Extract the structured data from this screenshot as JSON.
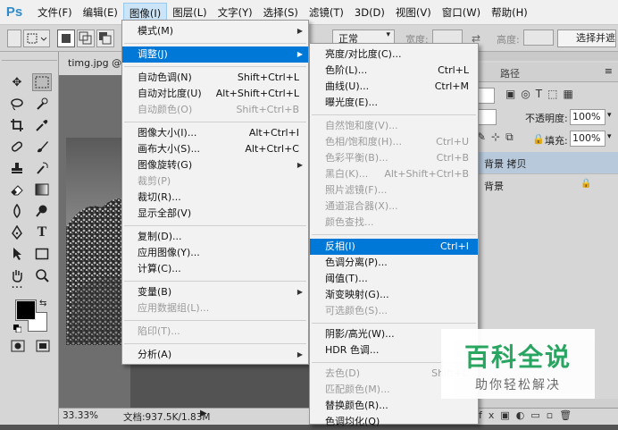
{
  "app": {
    "logo": "Ps"
  },
  "menubar": {
    "items": [
      "文件(F)",
      "编辑(E)",
      "图像(I)",
      "图层(L)",
      "文字(Y)",
      "选择(S)",
      "滤镜(T)",
      "3D(D)",
      "视图(V)",
      "窗口(W)",
      "帮助(H)"
    ],
    "active_index": 2
  },
  "options_bar": {
    "style_value": "正常",
    "width_label": "宽度:",
    "height_label": "高度:",
    "select_mask_label": "选择并遮"
  },
  "document": {
    "tab_title": "timg.jpg @",
    "zoom": "33.33%",
    "doc_info": "文档:937.5K/1.83M"
  },
  "panels": {
    "tabs": [
      "路径"
    ],
    "opacity_label": "不透明度:",
    "opacity_value": "100%",
    "fill_label": "填充:",
    "fill_value": "100%",
    "layers": [
      "背景 拷贝",
      "背景"
    ]
  },
  "image_menu": [
    {
      "label": "模式(M)",
      "submenu": true
    },
    {
      "sep": true
    },
    {
      "label": "调整(J)",
      "submenu": true,
      "highlighted": true
    },
    {
      "sep": true
    },
    {
      "label": "自动色调(N)",
      "shortcut": "Shift+Ctrl+L"
    },
    {
      "label": "自动对比度(U)",
      "shortcut": "Alt+Shift+Ctrl+L"
    },
    {
      "label": "自动颜色(O)",
      "shortcut": "Shift+Ctrl+B",
      "disabled": true
    },
    {
      "sep": true
    },
    {
      "label": "图像大小(I)...",
      "shortcut": "Alt+Ctrl+I"
    },
    {
      "label": "画布大小(S)...",
      "shortcut": "Alt+Ctrl+C"
    },
    {
      "label": "图像旋转(G)",
      "submenu": true
    },
    {
      "label": "裁剪(P)",
      "disabled": true
    },
    {
      "label": "裁切(R)..."
    },
    {
      "label": "显示全部(V)"
    },
    {
      "sep": true
    },
    {
      "label": "复制(D)..."
    },
    {
      "label": "应用图像(Y)..."
    },
    {
      "label": "计算(C)..."
    },
    {
      "sep": true
    },
    {
      "label": "变量(B)",
      "submenu": true
    },
    {
      "label": "应用数据组(L)...",
      "disabled": true
    },
    {
      "sep": true
    },
    {
      "label": "陷印(T)...",
      "disabled": true
    },
    {
      "sep": true
    },
    {
      "label": "分析(A)",
      "submenu": true
    }
  ],
  "adjust_menu": [
    {
      "label": "亮度/对比度(C)..."
    },
    {
      "label": "色阶(L)...",
      "shortcut": "Ctrl+L"
    },
    {
      "label": "曲线(U)...",
      "shortcut": "Ctrl+M"
    },
    {
      "label": "曝光度(E)..."
    },
    {
      "sep": true
    },
    {
      "label": "自然饱和度(V)...",
      "disabled": true
    },
    {
      "label": "色相/饱和度(H)...",
      "shortcut": "Ctrl+U",
      "disabled": true
    },
    {
      "label": "色彩平衡(B)...",
      "shortcut": "Ctrl+B",
      "disabled": true
    },
    {
      "label": "黑白(K)...",
      "shortcut": "Alt+Shift+Ctrl+B",
      "disabled": true
    },
    {
      "label": "照片滤镜(F)...",
      "disabled": true
    },
    {
      "label": "通道混合器(X)...",
      "disabled": true
    },
    {
      "label": "颜色查找...",
      "disabled": true
    },
    {
      "sep": true
    },
    {
      "label": "反相(I)",
      "shortcut": "Ctrl+I",
      "highlighted": true
    },
    {
      "label": "色调分离(P)..."
    },
    {
      "label": "阈值(T)..."
    },
    {
      "label": "渐变映射(G)..."
    },
    {
      "label": "可选颜色(S)...",
      "disabled": true
    },
    {
      "sep": true
    },
    {
      "label": "阴影/高光(W)..."
    },
    {
      "label": "HDR 色调..."
    },
    {
      "sep": true
    },
    {
      "label": "去色(D)",
      "shortcut": "Shift+C",
      "disabled": true
    },
    {
      "label": "匹配颜色(M)...",
      "disabled": true
    },
    {
      "label": "替换颜色(R)..."
    },
    {
      "label": "色调均化(Q)"
    }
  ],
  "watermark": {
    "title": "百科全说",
    "subtitle": "助你轻松解决"
  },
  "colors": {
    "menu_highlight": "#0078d7",
    "ps_blue": "#2f8cc9",
    "watermark_green": "#1fa35a"
  }
}
